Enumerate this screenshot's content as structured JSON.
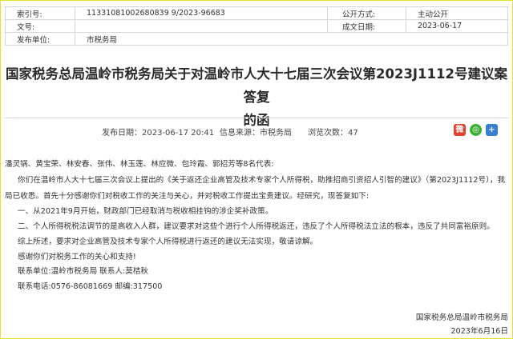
{
  "meta": {
    "index_label": "索引号:",
    "index_value": "11331081002680839 9/2023-96683",
    "public_mode_label": "公开方式:",
    "public_mode_value": "主动公开",
    "doc_no_label": "文号:",
    "doc_no_value": "",
    "created_label": "成文日期:",
    "created_value": "2023-06-17",
    "publisher_label": "发布单位:",
    "publisher_value": "市税务局"
  },
  "title": {
    "line1": "国家税务总局温岭市税务局关于对温岭市人大十七届三次会议第2023J1112号建议案答复",
    "line2": "的函"
  },
  "info": {
    "publish_date": "发布日期：2023-06-17 20:41",
    "source": "信息来源：市税务局",
    "views": "浏览次数：47"
  },
  "share_icons": [
    "weibo-icon",
    "wechat-icon",
    "more-share-icon"
  ],
  "body": {
    "p0": "潘灵锅、黄宝荣、林安春、张伟、林玉莲、林应微、包玲霞、郭招芳等8名代表:",
    "p1a": "你们在温岭市人大十七届三次会议上提出的《关于返还企业高管及技术专家个人所得税，助推招商引资招人引智的建议》（第2023J1112号），我",
    "p1b": "局已收悉。首先十分感谢你们对税收工作的关注与关心，并对税收工作提出宝贵建议。经研究，现答复如下:",
    "p2": "一、从2021年9月开始，财政部门已经取消与税收相挂钩的涉企奖补政策。",
    "p3": "二、个人所得税税法调节的是高收入人群，建议要求对这些个进行个人所得税返还，违反了个人所得税法立法的根本，违反了共同富裕原则。",
    "p4": "综上所述，要求对企业高管及技术专家个人所得税进行返还的建议无法实现，敬请谅解。",
    "p5": "感谢你们对税务工作的关心和支持!",
    "p6": "联系单位:温岭市税务局    联系人:莫桔秋",
    "p7": "联系电话:0576-86081669   邮编:317500"
  },
  "signature": {
    "org": "国家税务总局温岭市税务局",
    "date": "2023年6月16日"
  }
}
